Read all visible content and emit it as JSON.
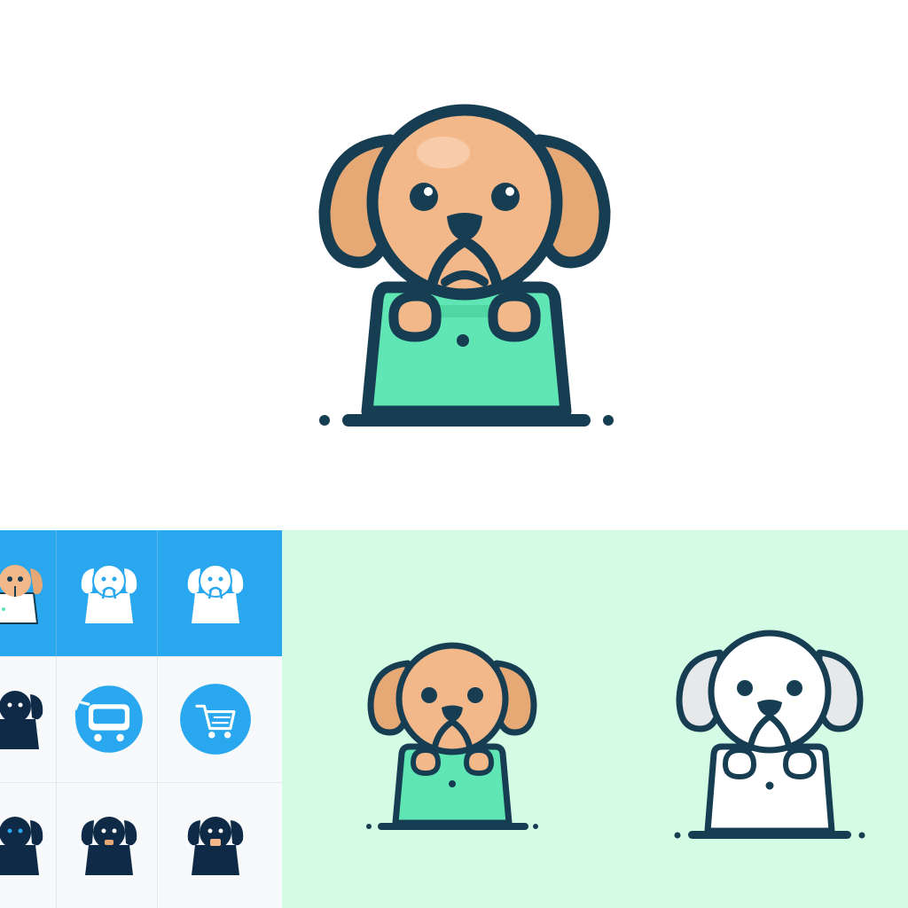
{
  "palette": {
    "outline": "#173d52",
    "fur": "#f2b88a",
    "ear": "#e6a874",
    "bag": "#5fe6b4",
    "bag_shadow": "#4fd6a2",
    "white": "#ffffff",
    "blue": "#2aa8ef",
    "mint_bg": "#d4fbe3",
    "navy": "#0e2a46"
  },
  "icons": {
    "hero": "dog-with-shopping-bag-icon",
    "grid": [
      [
        "dog-bag-color-icon",
        "dog-bag-white-icon",
        "dog-bag-white-icon"
      ],
      [
        "dog-bag-navy-icon",
        "shopping-cart-outline-icon",
        "shopping-cart-circle-icon"
      ],
      [
        "dog-bag-navy-icon",
        "dog-bag-navy-icon",
        "dog-bag-navy-icon"
      ]
    ],
    "mint": [
      "dog-bag-color-icon",
      "dog-bag-outline-icon"
    ]
  }
}
